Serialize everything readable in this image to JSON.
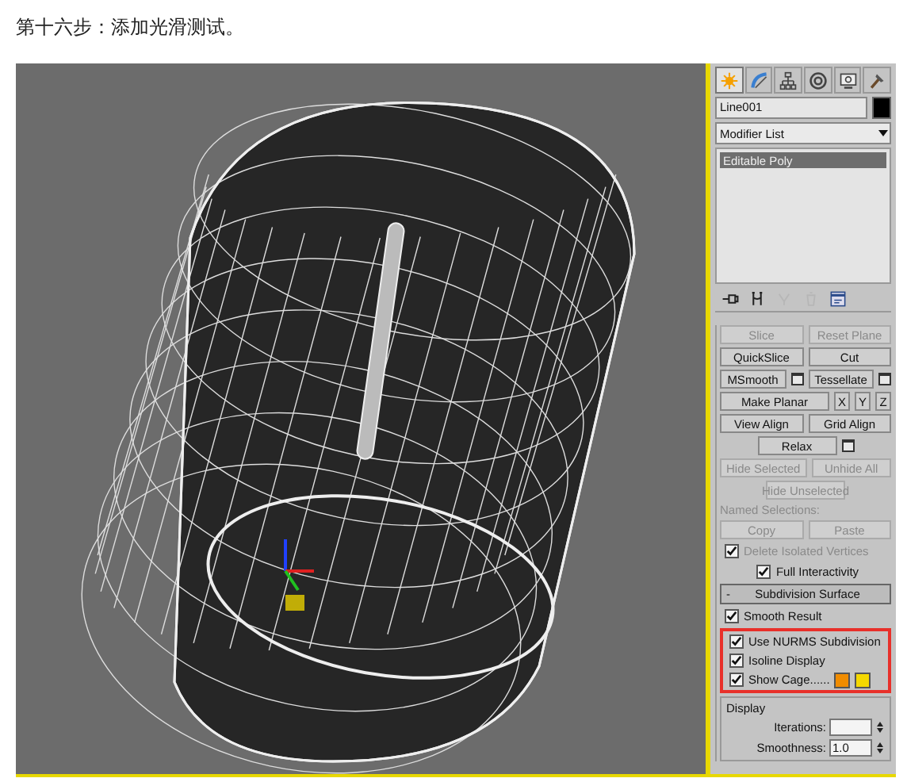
{
  "caption": "第十六步：添加光滑测试。",
  "command_panel": {
    "tabs": [
      {
        "selected": true
      },
      {
        "selected": false
      },
      {
        "selected": false
      },
      {
        "selected": false
      },
      {
        "selected": false
      },
      {
        "selected": false
      }
    ],
    "object_name": "Line001",
    "modifier_list": "Modifier List",
    "stack": [
      {
        "label": "Editable Poly",
        "selected": true
      }
    ],
    "stack_tools": [
      {
        "disabled": false
      },
      {
        "disabled": false
      },
      {
        "disabled": true
      },
      {
        "disabled": true
      },
      {
        "disabled": false
      }
    ],
    "controls": [
      {
        "kind": "buttons",
        "items": [
          {
            "label": "Slice",
            "disabled": true,
            "settings": false
          },
          {
            "label": "Reset Plane",
            "disabled": true,
            "settings": false
          }
        ]
      },
      {
        "kind": "buttons",
        "items": [
          {
            "label": "QuickSlice",
            "disabled": false,
            "settings": false
          },
          {
            "label": "Cut",
            "disabled": false,
            "settings": false
          }
        ]
      },
      {
        "kind": "buttons",
        "items": [
          {
            "label": "MSmooth",
            "disabled": false,
            "settings": true
          },
          {
            "label": "Tessellate",
            "disabled": false,
            "settings": true
          }
        ]
      },
      {
        "kind": "buttons",
        "items": [
          {
            "label": "Make Planar",
            "disabled": false,
            "settings": false
          },
          {
            "label": "X",
            "disabled": false,
            "settings": false
          },
          {
            "label": "Y",
            "disabled": false,
            "settings": false
          },
          {
            "label": "Z",
            "disabled": false,
            "settings": false
          }
        ]
      },
      {
        "kind": "buttons",
        "items": [
          {
            "label": "View Align",
            "disabled": false,
            "settings": false
          },
          {
            "label": "Grid Align",
            "disabled": false,
            "settings": false
          }
        ]
      },
      {
        "kind": "buttons",
        "items": [
          {
            "label": "Relax",
            "disabled": false,
            "settings": true
          }
        ]
      },
      {
        "kind": "buttons",
        "items": [
          {
            "label": "Hide Selected",
            "disabled": true,
            "settings": false
          },
          {
            "label": "Unhide All",
            "disabled": true,
            "settings": false
          }
        ]
      },
      {
        "kind": "buttons",
        "items": [
          {
            "label": "Hide Unselected",
            "disabled": true,
            "settings": false
          }
        ]
      },
      {
        "kind": "label",
        "label": "Named Selections:",
        "disabled": true
      },
      {
        "kind": "buttons",
        "items": [
          {
            "label": "Copy",
            "disabled": true,
            "settings": false
          },
          {
            "label": "Paste",
            "disabled": true,
            "settings": false
          }
        ]
      },
      {
        "kind": "checkbox",
        "label": "Delete Isolated Vertices",
        "checked": true,
        "disabled": true
      },
      {
        "kind": "checkbox",
        "label": "Full Interactivity",
        "checked": true,
        "disabled": false
      },
      {
        "kind": "rollout",
        "label": "Subdivision Surface",
        "sign": "-"
      },
      {
        "kind": "checkbox",
        "label": "Smooth Result",
        "checked": true,
        "disabled": false
      },
      {
        "kind": "highlight",
        "items": [
          {
            "kind": "checkbox",
            "label": "Use NURMS Subdivision",
            "checked": true,
            "disabled": false
          },
          {
            "kind": "checkbox",
            "label": "Isoline Display",
            "checked": true,
            "disabled": false
          },
          {
            "kind": "cage",
            "label": "Show Cage......",
            "checked": true,
            "disabled": false,
            "swatches": [
              {
                "color": "#f08c00"
              },
              {
                "color": "#f5d800"
              }
            ]
          }
        ]
      },
      {
        "kind": "group",
        "title": "Display",
        "items": [
          {
            "label": "Iterations:",
            "value": ""
          },
          {
            "label": "Smoothness:",
            "value": "1.0"
          }
        ]
      }
    ]
  }
}
